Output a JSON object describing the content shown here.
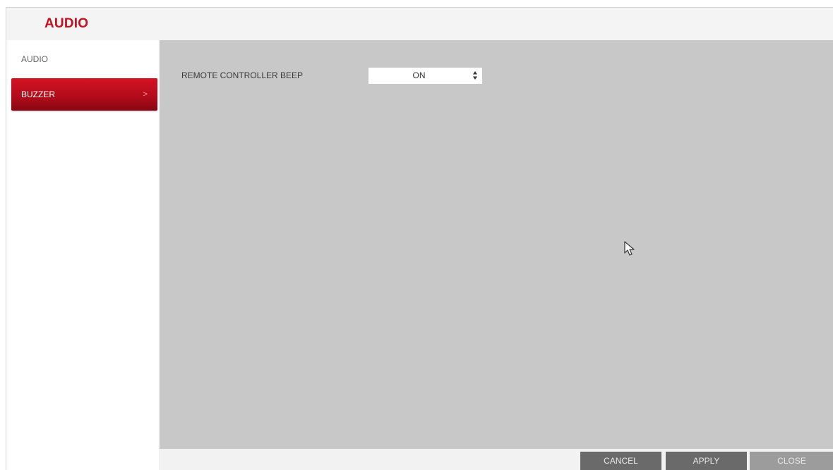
{
  "header": {
    "title": "AUDIO"
  },
  "sidebar": {
    "items": [
      {
        "label": "AUDIO",
        "active": false
      },
      {
        "label": "BUZZER",
        "active": true,
        "chevron": ">"
      }
    ]
  },
  "main": {
    "settings": [
      {
        "label": "REMOTE CONTROLLER BEEP",
        "value": "ON",
        "options_visible": [
          "ON"
        ]
      }
    ]
  },
  "footer": {
    "buttons": {
      "cancel": "CANCEL",
      "apply": "APPLY",
      "close": "CLOSE"
    }
  },
  "colors": {
    "accent": "#c4101f",
    "content_bg": "#c8c8c8",
    "button_bg": "#6a6a6a"
  },
  "icons": {
    "select_arrows": "up-down-arrows-icon",
    "menu_chevron": "chevron-right-icon",
    "cursor": "mouse-pointer-icon"
  }
}
